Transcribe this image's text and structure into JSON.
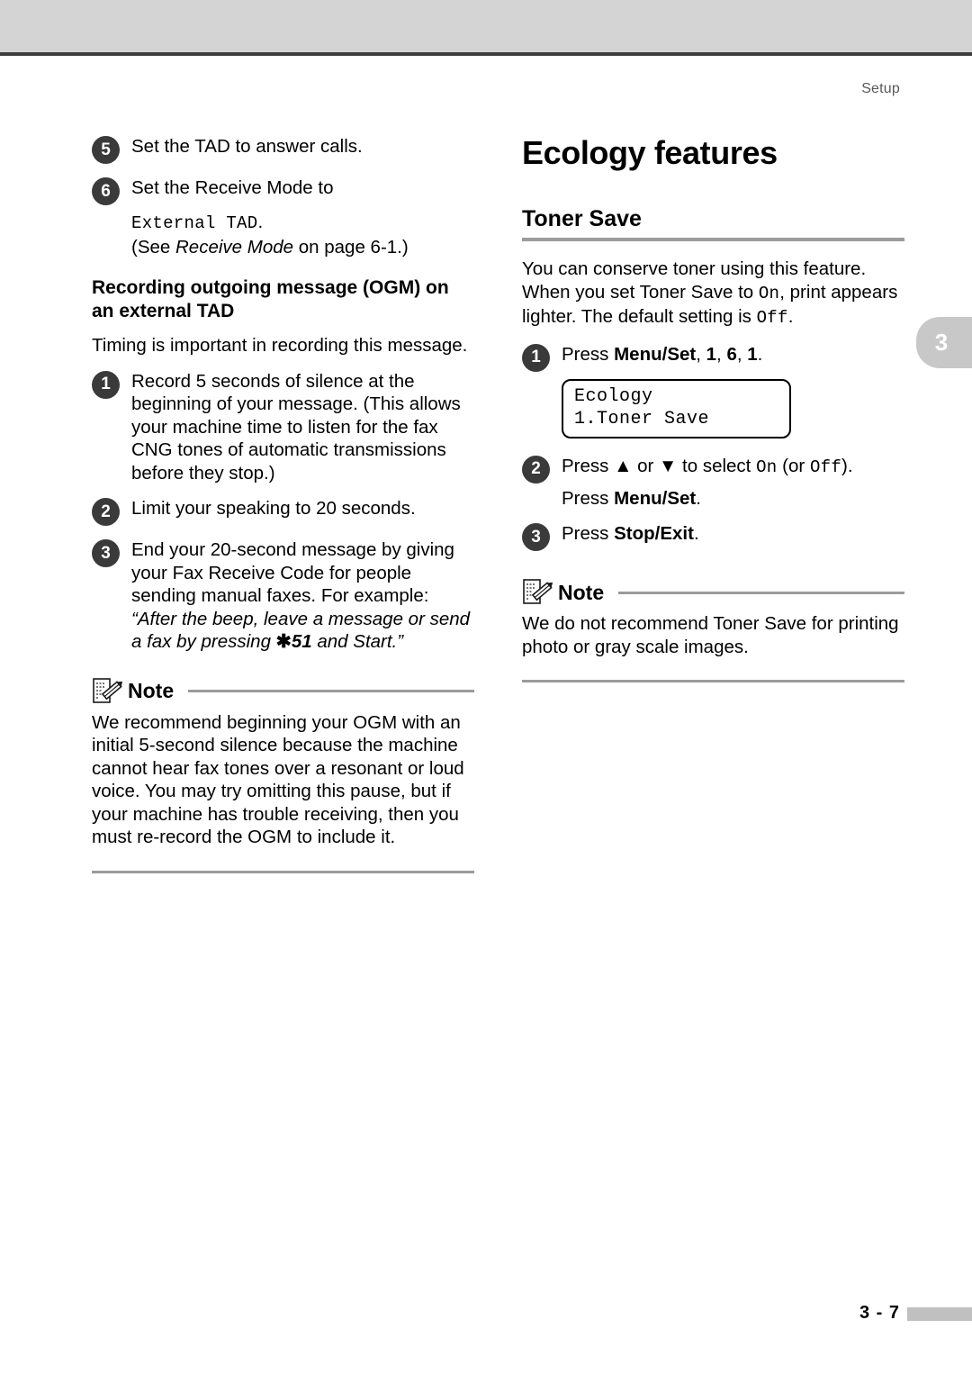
{
  "header": {
    "running_head": "Setup"
  },
  "chapter_tab": {
    "number": "3"
  },
  "footer": {
    "page_number": "3 - 7"
  },
  "left_column": {
    "steps_continued": [
      {
        "number": "5",
        "text": "Set the TAD to answer calls."
      },
      {
        "number": "6",
        "text": "Set the Receive Mode to"
      }
    ],
    "step6_mono": "External TAD",
    "step6_mono_period": ".",
    "step6_crossref_prefix": "(See ",
    "step6_crossref_italic": "Receive Mode",
    "step6_crossref_suffix": " on page 6-1.)",
    "heading": "Recording outgoing message (OGM) on an external TAD",
    "intro": "Timing is important in recording this message.",
    "steps": [
      {
        "number": "1",
        "text": "Record 5 seconds of silence at the beginning of your message. (This allows your machine time to listen for the fax CNG tones of automatic transmissions before they stop.)"
      },
      {
        "number": "2",
        "text": "Limit your speaking to 20 seconds."
      },
      {
        "number": "3",
        "text": "End your 20-second message by giving your Fax Receive Code for people sending manual faxes. For example:",
        "example_part1": "“After the beep, leave a message or send a fax by pressing ",
        "example_symbol": "✱",
        "example_code": "51",
        "example_part2": " and Start.”"
      }
    ],
    "note": {
      "label": "Note",
      "icon": "note-pencil-icon",
      "body": "We recommend beginning your OGM with an initial 5-second silence because the machine cannot hear fax tones over a resonant or loud voice. You may try omitting this pause, but if your machine has trouble receiving, then you must re-record the OGM to include it."
    }
  },
  "right_column": {
    "title": "Ecology features",
    "section_heading": "Toner Save",
    "intro_part1": "You can conserve toner using this feature. When you set Toner Save to ",
    "intro_mono_on": "On",
    "intro_part2": ", print appears lighter. The default setting is ",
    "intro_mono_off": "Off",
    "intro_part3": ".",
    "steps": [
      {
        "number": "1",
        "prefix": "Press ",
        "bold1": "Menu/Set",
        "mid": ", ",
        "bold2": "1",
        "mid2": ", ",
        "bold3": "6",
        "mid3": ", ",
        "bold4": "1",
        "suffix": "."
      },
      {
        "number": "2",
        "line1_prefix": "Press ",
        "up_arrow": "▲",
        "line1_mid": " or ",
        "down_arrow": "▼",
        "line1_mid2": " to select ",
        "mono_on": "On",
        "line1_mid3": " (or ",
        "mono_off": "Off",
        "line1_suffix": ").",
        "line2_prefix": "Press ",
        "line2_bold": "Menu/Set",
        "line2_suffix": "."
      },
      {
        "number": "3",
        "prefix": "Press ",
        "bold1": "Stop/Exit",
        "suffix": "."
      }
    ],
    "lcd": {
      "line1": "Ecology",
      "line2": "1.Toner Save"
    },
    "note": {
      "label": "Note",
      "icon": "note-pencil-icon",
      "body": "We do not recommend Toner Save for printing photo or gray scale images."
    }
  }
}
